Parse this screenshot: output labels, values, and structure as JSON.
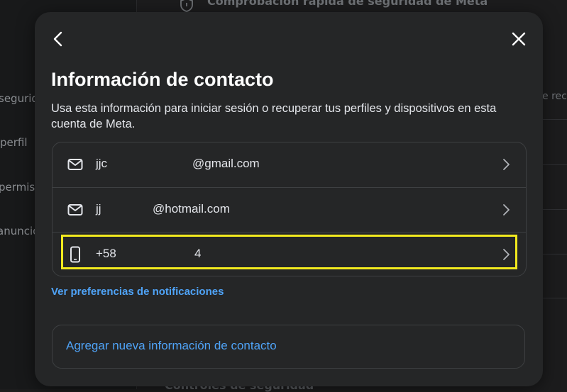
{
  "background": {
    "top_text": "Comprobación rápida de seguridad de Meta",
    "nav_items": [
      "seguridad",
      "perfil",
      "permisos",
      "anuncios"
    ],
    "right_text": "e rec",
    "bottom_text": "Controles de seguridad"
  },
  "modal": {
    "title": "Información de contacto",
    "subtitle": "Usa esta información para iniciar sesión o recuperar tus perfiles y dispositivos en esta cuenta de Meta.",
    "contacts": [
      {
        "icon": "mail-icon",
        "prefix": "jjc",
        "suffix": "@gmail.com"
      },
      {
        "icon": "mail-icon",
        "prefix": "jj",
        "suffix": "@hotmail.com"
      },
      {
        "icon": "phone-icon",
        "prefix": "+58",
        "suffix": "4"
      }
    ],
    "notifications_link": "Ver preferencias de notificaciones",
    "add_contact_label": "Agregar nueva información de contacto"
  },
  "colors": {
    "modal_bg": "#252627",
    "accent_link": "#4fa3f7",
    "highlight": "#f2ea1e"
  }
}
